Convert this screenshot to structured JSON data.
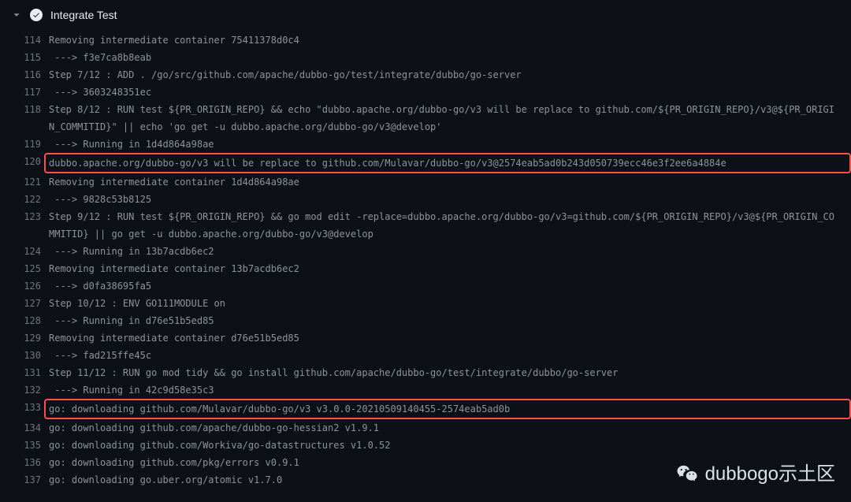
{
  "header": {
    "title": "Integrate Test"
  },
  "lines": [
    {
      "n": "114",
      "text": "Removing intermediate container 75411378d0c4",
      "highlighted": false
    },
    {
      "n": "115",
      "text": " ---> f3e7ca8b8eab",
      "highlighted": false
    },
    {
      "n": "116",
      "text": "Step 7/12 : ADD . /go/src/github.com/apache/dubbo-go/test/integrate/dubbo/go-server",
      "highlighted": false
    },
    {
      "n": "117",
      "text": " ---> 3603248351ec",
      "highlighted": false
    },
    {
      "n": "118",
      "text": "Step 8/12 : RUN test ${PR_ORIGIN_REPO} && echo \"dubbo.apache.org/dubbo-go/v3 will be replace to github.com/${PR_ORIGIN_REPO}/v3@${PR_ORIGIN_COMMITID}\" || echo 'go get -u dubbo.apache.org/dubbo-go/v3@develop'",
      "highlighted": false
    },
    {
      "n": "119",
      "text": " ---> Running in 1d4d864a98ae",
      "highlighted": false
    },
    {
      "n": "120",
      "text": "dubbo.apache.org/dubbo-go/v3 will be replace to github.com/Mulavar/dubbo-go/v3@2574eab5ad0b243d050739ecc46e3f2ee6a4884e",
      "highlighted": true
    },
    {
      "n": "121",
      "text": "Removing intermediate container 1d4d864a98ae",
      "highlighted": false
    },
    {
      "n": "122",
      "text": " ---> 9828c53b8125",
      "highlighted": false
    },
    {
      "n": "123",
      "text": "Step 9/12 : RUN test ${PR_ORIGIN_REPO} && go mod edit -replace=dubbo.apache.org/dubbo-go/v3=github.com/${PR_ORIGIN_REPO}/v3@${PR_ORIGIN_COMMITID} || go get -u dubbo.apache.org/dubbo-go/v3@develop",
      "highlighted": false
    },
    {
      "n": "124",
      "text": " ---> Running in 13b7acdb6ec2",
      "highlighted": false
    },
    {
      "n": "125",
      "text": "Removing intermediate container 13b7acdb6ec2",
      "highlighted": false
    },
    {
      "n": "126",
      "text": " ---> d0fa38695fa5",
      "highlighted": false
    },
    {
      "n": "127",
      "text": "Step 10/12 : ENV GO111MODULE on",
      "highlighted": false
    },
    {
      "n": "128",
      "text": " ---> Running in d76e51b5ed85",
      "highlighted": false
    },
    {
      "n": "129",
      "text": "Removing intermediate container d76e51b5ed85",
      "highlighted": false
    },
    {
      "n": "130",
      "text": " ---> fad215ffe45c",
      "highlighted": false
    },
    {
      "n": "131",
      "text": "Step 11/12 : RUN go mod tidy && go install github.com/apache/dubbo-go/test/integrate/dubbo/go-server",
      "highlighted": false
    },
    {
      "n": "132",
      "text": " ---> Running in 42c9d58e35c3",
      "highlighted": false
    },
    {
      "n": "133",
      "text": "go: downloading github.com/Mulavar/dubbo-go/v3 v3.0.0-20210509140455-2574eab5ad0b",
      "highlighted": true
    },
    {
      "n": "134",
      "text": "go: downloading github.com/apache/dubbo-go-hessian2 v1.9.1",
      "highlighted": false
    },
    {
      "n": "135",
      "text": "go: downloading github.com/Workiva/go-datastructures v1.0.52",
      "highlighted": false
    },
    {
      "n": "136",
      "text": "go: downloading github.com/pkg/errors v0.9.1",
      "highlighted": false
    },
    {
      "n": "137",
      "text": "go: downloading go.uber.org/atomic v1.7.0",
      "highlighted": false
    }
  ],
  "watermark": {
    "text": "dubbogo示土区"
  }
}
